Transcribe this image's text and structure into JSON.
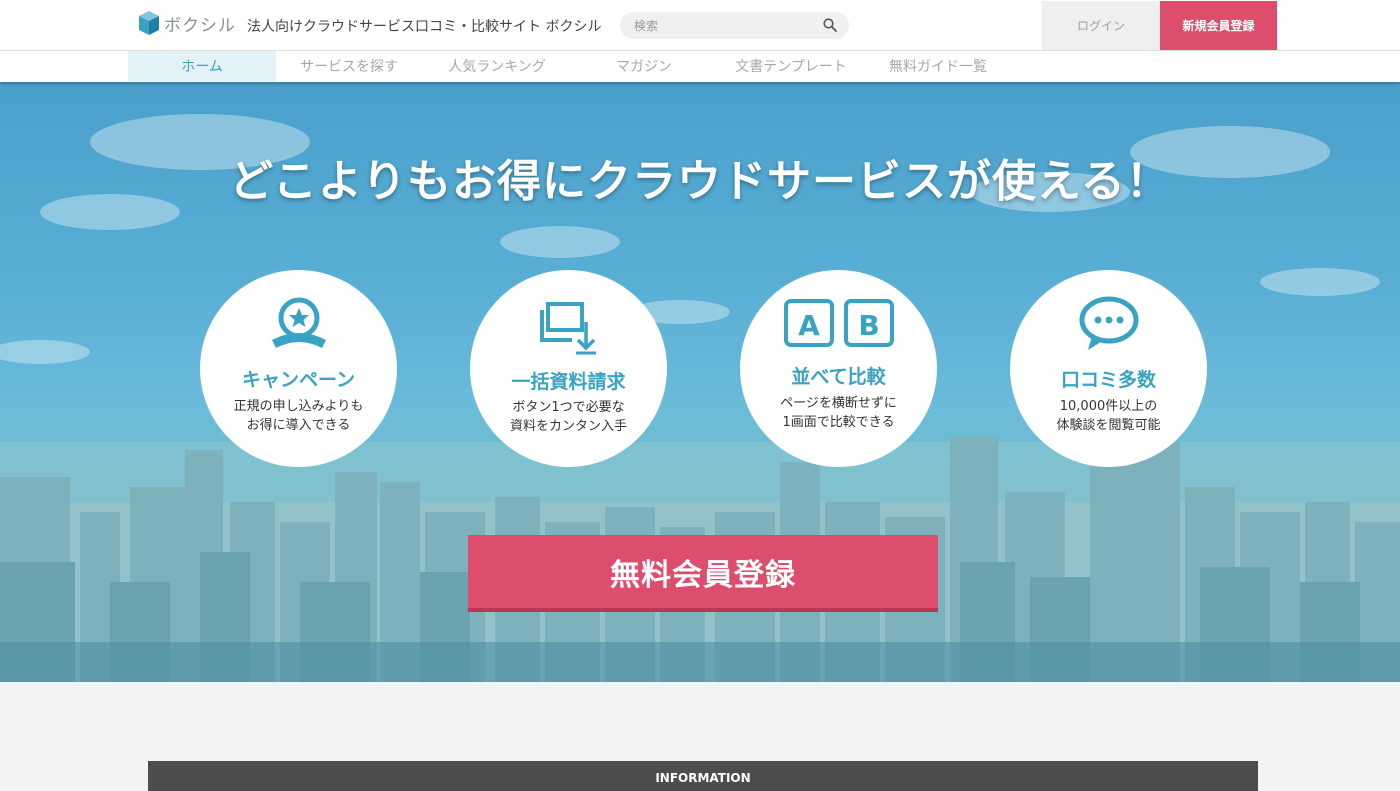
{
  "header": {
    "logo_text": "ボクシル",
    "tagline": "法人向けクラウドサービス口コミ・比較サイト ボクシル",
    "search_placeholder": "検索",
    "login_label": "ログイン",
    "register_label": "新規会員登録"
  },
  "nav": {
    "items": [
      {
        "label": "ホーム"
      },
      {
        "label": "サービスを探す"
      },
      {
        "label": "人気ランキング"
      },
      {
        "label": "マガジン"
      },
      {
        "label": "文書テンプレート"
      },
      {
        "label": "無料ガイド一覧"
      }
    ]
  },
  "hero": {
    "title": "どこよりもお得にクラウドサービスが使える！",
    "features": [
      {
        "title": "キャンペーン",
        "desc_line1": "正規の申し込みよりも",
        "desc_line2": "お得に導入できる",
        "icon": "award-badge-icon"
      },
      {
        "title": "一括資料請求",
        "desc_line1": "ボタン1つで必要な",
        "desc_line2": "資料をカンタン入手",
        "icon": "document-download-icon"
      },
      {
        "title": "並べて比較",
        "desc_line1": "ページを横断せずに",
        "desc_line2": "1画面で比較できる",
        "icon": "ab-compare-icon",
        "icon_letter_a": "A",
        "icon_letter_b": "B"
      },
      {
        "title": "口コミ多数",
        "desc_line1": "10,000件以上の",
        "desc_line2": "体験談を閲覧可能",
        "icon": "speech-bubble-icon"
      }
    ],
    "cta_label": "無料会員登録"
  },
  "info": {
    "title": "INFORMATION"
  },
  "colors": {
    "accent_blue": "#3aa3c4",
    "accent_pink": "#dd4d6c"
  }
}
